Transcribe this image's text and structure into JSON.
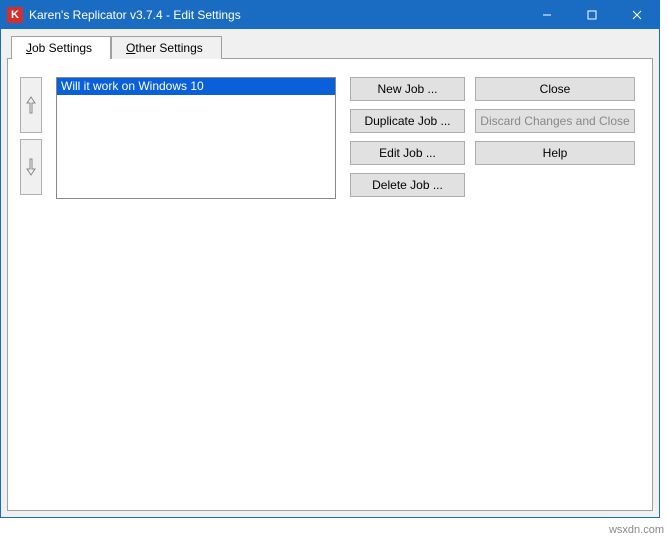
{
  "window": {
    "title": "Karen's Replicator v3.7.4 - Edit Settings",
    "icon_letter": "K"
  },
  "tabs": {
    "job_settings": "Job Settings",
    "other_settings": "Other Settings"
  },
  "job_list": {
    "items": [
      "Will it work on Windows 10"
    ]
  },
  "buttons": {
    "new_job": "New Job ...",
    "duplicate_job": "Duplicate Job ...",
    "edit_job": "Edit Job ...",
    "delete_job": "Delete Job ...",
    "close": "Close",
    "discard": "Discard Changes and Close",
    "help": "Help"
  },
  "watermark": "wsxdn.com"
}
